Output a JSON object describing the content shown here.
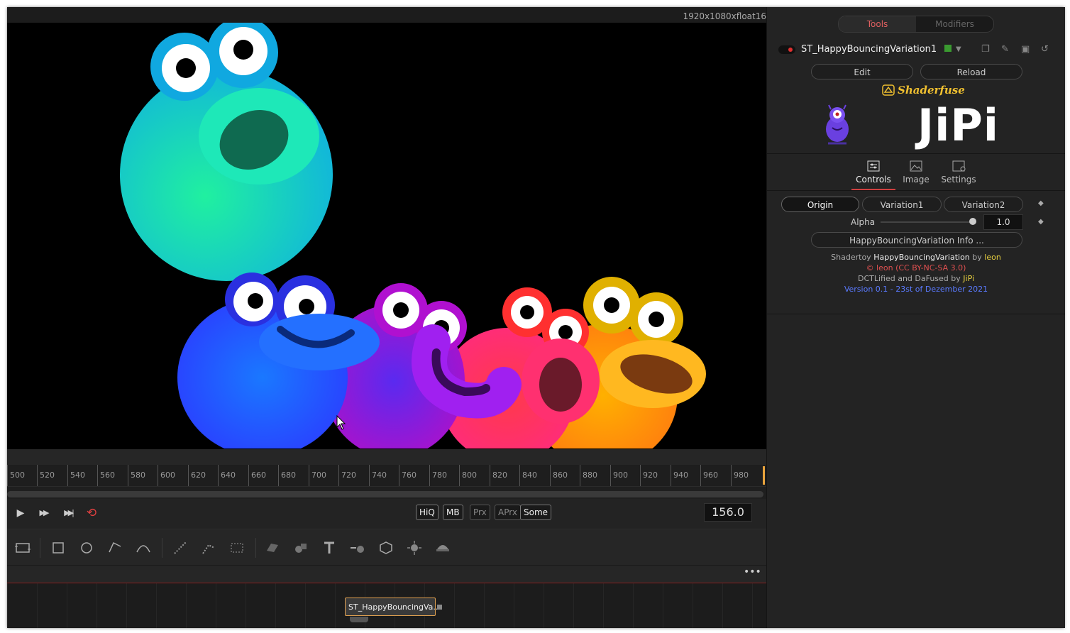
{
  "viewer": {
    "resolution": "1920x1080xfloat16"
  },
  "ruler": {
    "ticks": [
      "500",
      "520",
      "540",
      "560",
      "580",
      "600",
      "620",
      "640",
      "660",
      "680",
      "700",
      "720",
      "740",
      "760",
      "780",
      "800",
      "820",
      "840",
      "860",
      "880",
      "900",
      "920",
      "940",
      "960",
      "980"
    ]
  },
  "transport": {
    "play_icon": "▶",
    "ff_icon": "▶▶",
    "end_icon": "▶▶|",
    "loop_icon": "⟲",
    "quality": [
      "HiQ",
      "MB",
      "Prx",
      "APrx",
      "Some"
    ],
    "frame": "156.0"
  },
  "node_editor": {
    "node_label": "ST_HappyBouncingVa...",
    "more": "•••"
  },
  "inspector": {
    "tabs": {
      "tools": "Tools",
      "modifiers": "Modifiers"
    },
    "tool_name": "ST_HappyBouncingVariation1",
    "edit": "Edit",
    "reload": "Reload",
    "logo": "Shaderfuse",
    "big_title": "JiPi",
    "sub_tabs": {
      "controls": "Controls",
      "image": "Image",
      "settings": "Settings"
    },
    "variations": [
      "Origin",
      "Variation1",
      "Variation2"
    ],
    "alpha_label": "Alpha",
    "alpha_value": "1.0",
    "info_button": "HappyBouncingVariation Info ...",
    "credits": {
      "l1a": "Shadertoy ",
      "l1b": "HappyBouncingVariation",
      "l1c": " by ",
      "l1d": "leon",
      "l2": "© leon (CC BY-NC-SA 3.0)",
      "l3a": "DCTLified and DaFused by ",
      "l3b": "JiPi",
      "l4": "Version 0.1 - 23st of Dezember 2021"
    }
  },
  "colors": {
    "accent_red": "#e05050",
    "yellow": "#e8d040",
    "blue_link": "#5a7aff",
    "playhead": "#e8a33c"
  }
}
